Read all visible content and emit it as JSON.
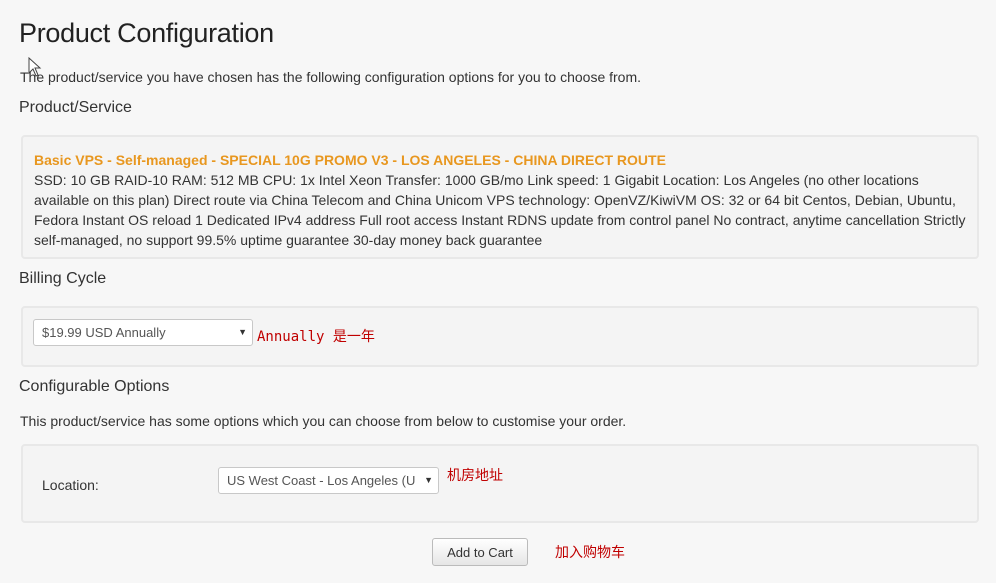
{
  "page": {
    "title": "Product Configuration",
    "intro": "The product/service you have chosen has the following configuration options for you to choose from."
  },
  "product_section": {
    "heading": "Product/Service",
    "name": "Basic VPS - Self-managed - SPECIAL 10G PROMO V3 - LOS ANGELES - CHINA DIRECT ROUTE",
    "description": "SSD: 10 GB RAID-10 RAM: 512 MB CPU: 1x Intel Xeon Transfer: 1000 GB/mo Link speed: 1 Gigabit Location: Los Angeles (no other locations available on this plan) Direct route via China Telecom and China Unicom VPS technology: OpenVZ/KiwiVM OS: 32 or 64 bit Centos, Debian, Ubuntu, Fedora Instant OS reload 1 Dedicated IPv4 address Full root access Instant RDNS update from control panel No contract, anytime cancellation Strictly self-managed, no support 99.5% uptime guarantee 30-day money back guarantee"
  },
  "billing": {
    "heading": "Billing Cycle",
    "selected": "$19.99 USD Annually",
    "note": "Annually 是一年"
  },
  "configurable": {
    "heading": "Configurable Options",
    "intro": "This product/service has some options which you can choose from below to customise your order.",
    "location_label": "Location:",
    "location_selected": "US West Coast - Los Angeles (U",
    "note": "机房地址"
  },
  "cart": {
    "button_label": "Add to Cart",
    "note": "加入购物车"
  },
  "colors": {
    "product_name": "#e8971f",
    "annotation": "#c00000"
  }
}
